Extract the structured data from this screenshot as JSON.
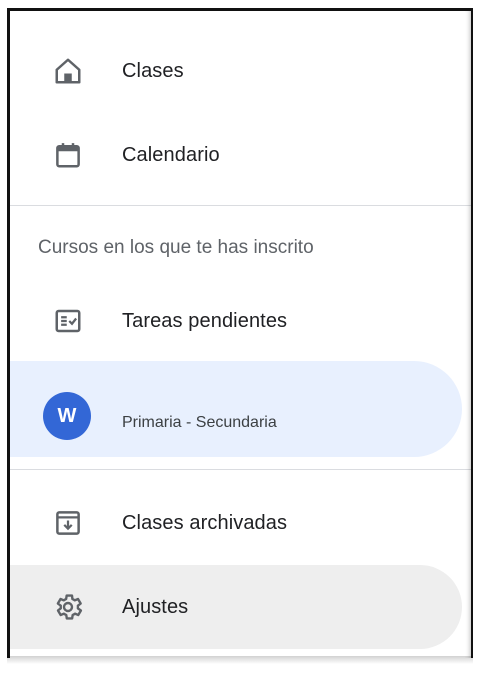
{
  "nav": {
    "classes_label": "Clases",
    "calendar_label": "Calendario",
    "section_header": "Cursos en los que te has inscrito",
    "todo_label": "Tareas pendientes",
    "enrolled_class": {
      "avatar_letter": "W",
      "subtitle": "Primaria - Secundaria"
    },
    "archived_label": "Clases archivadas",
    "settings_label": "Ajustes"
  },
  "colors": {
    "selected_bg": "#e8f0fe",
    "avatar_bg": "#3367d6",
    "hover_bg": "#eeeeee",
    "icon": "#5f6368"
  },
  "icons": {
    "classes": "home-icon",
    "calendar": "calendar-icon",
    "todo": "checklist-icon",
    "archived": "archive-icon",
    "settings": "gear-icon"
  }
}
